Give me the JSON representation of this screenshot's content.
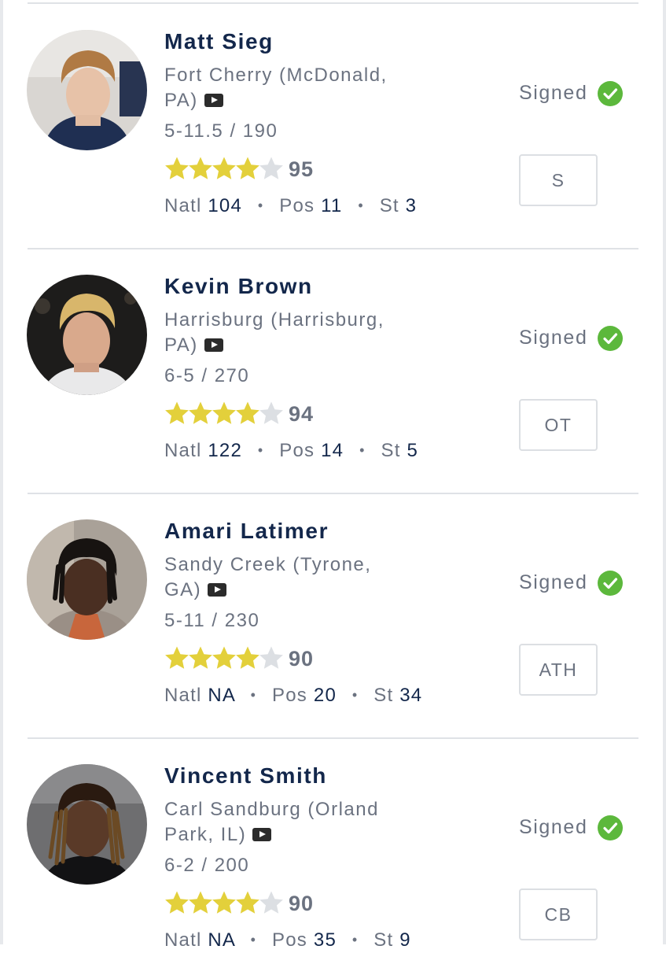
{
  "recruits": [
    {
      "name": "Matt Sieg",
      "school": "Fort Cherry (McDonald, PA)",
      "measurements": "5-11.5 / 190",
      "stars": 4,
      "rating": "95",
      "rank_natl_label": "Natl",
      "rank_natl": "104",
      "rank_pos_label": "Pos",
      "rank_pos": "11",
      "rank_st_label": "St",
      "rank_st": "3",
      "status": "Signed",
      "position": "S"
    },
    {
      "name": "Kevin Brown",
      "school": "Harrisburg (Harrisburg, PA)",
      "measurements": "6-5 / 270",
      "stars": 4,
      "rating": "94",
      "rank_natl_label": "Natl",
      "rank_natl": "122",
      "rank_pos_label": "Pos",
      "rank_pos": "14",
      "rank_st_label": "St",
      "rank_st": "5",
      "status": "Signed",
      "position": "OT"
    },
    {
      "name": "Amari Latimer",
      "school": "Sandy Creek (Tyrone, GA)",
      "measurements": "5-11 / 230",
      "stars": 4,
      "rating": "90",
      "rank_natl_label": "Natl",
      "rank_natl": "NA",
      "rank_pos_label": "Pos",
      "rank_pos": "20",
      "rank_st_label": "St",
      "rank_st": "34",
      "status": "Signed",
      "position": "ATH"
    },
    {
      "name": "Vincent Smith",
      "school": "Carl Sandburg (Orland Park, IL)",
      "measurements": "6-2 / 200",
      "stars": 4,
      "rating": "90",
      "rank_natl_label": "Natl",
      "rank_natl": "NA",
      "rank_pos_label": "Pos",
      "rank_pos": "35",
      "rank_st_label": "St",
      "rank_st": "9",
      "status": "Signed",
      "position": "CB"
    }
  ],
  "icons": {
    "video": "video-icon",
    "check": "check-circle-icon",
    "star": "star-icon"
  },
  "colors": {
    "name": "#13274b",
    "muted": "#6b7280",
    "star_filled": "#e3d03b",
    "star_empty": "#dcdfe3",
    "signed_check": "#5cb83c"
  }
}
